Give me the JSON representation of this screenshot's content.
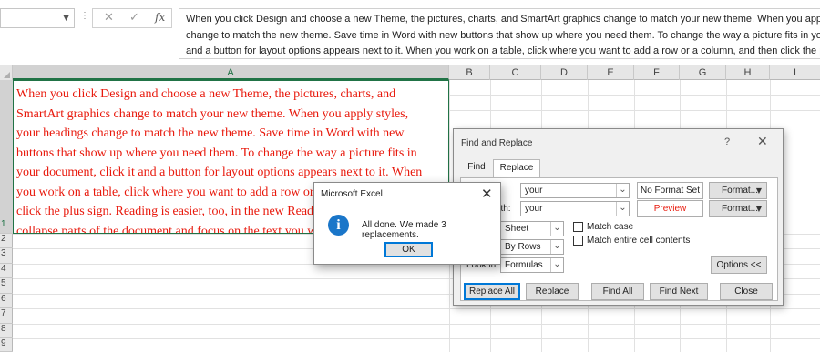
{
  "formula_bar": {
    "name_box_value": "",
    "cancel_glyph": "✕",
    "enter_glyph": "✓",
    "fx_label": "fx",
    "content": "When you click Design and choose a new Theme, the pictures, charts, and SmartArt graphics change to match your new theme. When you apply st\nchange to match the new theme. Save time in Word with new buttons that show up where you need them. To change the way a picture fits in yo\nand a button for layout options appears next to it. When you work on a table, click where you want to add a row or a column, and then click the p"
  },
  "grid": {
    "columns": [
      "A",
      "B",
      "C",
      "D",
      "E",
      "F",
      "G",
      "H",
      "I"
    ],
    "rows": [
      "1",
      "2",
      "3",
      "4",
      "5",
      "6",
      "7",
      "8",
      "9"
    ],
    "selected_column": "A",
    "selected_row": "1",
    "cell_A1_text": "When you click Design and choose a new Theme, the pictures, charts, and\nSmartArt graphics change to match your new theme. When you apply styles,\nyour headings change to match the new theme. Save time in Word with new\nbuttons that show up where you need them. To change the way a picture fits in\nyour document, click it and a button for layout options appears next to it. When\nyou work on a table, click where you want to add a row or a column, and then\nclick the plus sign. Reading is easier, too, in the new Reading view. You can\ncollapse parts of the document and focus on the text you want.",
    "cell_A1_color": "#e8190c"
  },
  "find_replace": {
    "title": "Find and Replace",
    "help_glyph": "?",
    "close_glyph": "✕",
    "tabs": {
      "find": "Find",
      "replace": "Replace"
    },
    "find_what_label": "t:",
    "find_what_value": "your",
    "replace_with_label": "with:",
    "replace_with_value": "your",
    "no_format_set": "No Format Set",
    "preview": "Preview",
    "format_button": "Format...",
    "within_value": "Sheet",
    "search_value": "By Rows",
    "look_in_label": "Look in:",
    "look_in_value": "Formulas",
    "match_case_label": "Match case",
    "match_entire_label": "Match entire cell contents",
    "options_button": "Options <<",
    "replace_all": "Replace All",
    "replace": "Replace",
    "find_all": "Find All",
    "find_next": "Find Next",
    "close": "Close",
    "preview_color": "#e8190c"
  },
  "message_box": {
    "title": "Microsoft Excel",
    "close_glyph": "✕",
    "icon_glyph": "i",
    "message": "All done. We made 3 replacements.",
    "ok": "OK",
    "icon_color": "#1a76c9"
  }
}
